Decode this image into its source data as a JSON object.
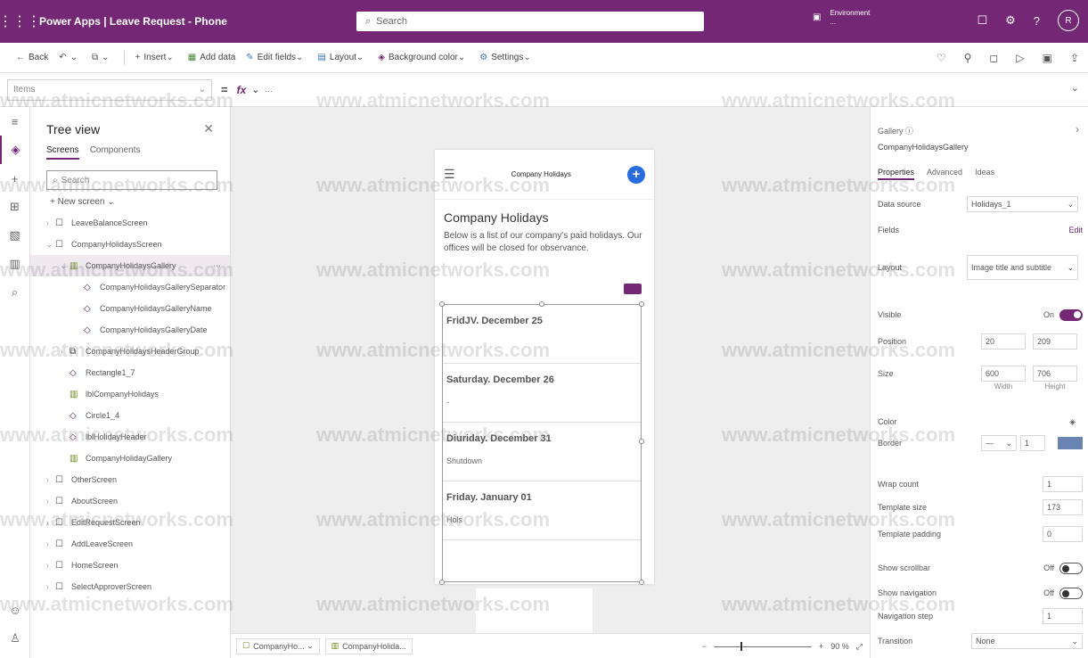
{
  "app": {
    "title": "Power Apps | Leave Request - Phone",
    "search_placeholder": "Search",
    "environment_line1": "Environment",
    "environment_line2": "...",
    "avatar_initials": "R"
  },
  "commandbar": {
    "back": "Back",
    "insert": "Insert",
    "add_data": "Add data",
    "edit_fields": "Edit fields",
    "layout": "Layout",
    "background_color": "Background color",
    "settings": "Settings"
  },
  "formulabar": {
    "property": "Items",
    "formula": "..."
  },
  "tree": {
    "title": "Tree view",
    "tabs": [
      "Screens",
      "Components"
    ],
    "search_placeholder": "Search",
    "new_screen": "New screen",
    "items": [
      {
        "label": "LeaveBalanceScreen",
        "indent": 0,
        "type": "screen",
        "chev": "›"
      },
      {
        "label": "CompanyHolidaysScreen",
        "indent": 0,
        "type": "screen",
        "chev": "⌄"
      },
      {
        "label": "CompanyHolidaysGallery",
        "indent": 1,
        "type": "gallery",
        "chev": "⌄",
        "selected": true
      },
      {
        "label": "CompanyHolidaysGallerySeparator",
        "indent": 2,
        "type": "control",
        "chev": ""
      },
      {
        "label": "CompanyHolidaysGalleryName",
        "indent": 2,
        "type": "control",
        "chev": ""
      },
      {
        "label": "CompanyHolidaysGalleryDate",
        "indent": 2,
        "type": "control",
        "chev": ""
      },
      {
        "label": "CompanyHolidaysHeaderGroup",
        "indent": 1,
        "type": "group",
        "chev": "›"
      },
      {
        "label": "Rectangle1_7",
        "indent": 1,
        "type": "control",
        "chev": ""
      },
      {
        "label": "lblCompanyHolidays",
        "indent": 1,
        "type": "gallery",
        "chev": ""
      },
      {
        "label": "Circle1_4",
        "indent": 1,
        "type": "control",
        "chev": ""
      },
      {
        "label": "lblHolidayHeader",
        "indent": 1,
        "type": "control",
        "chev": ""
      },
      {
        "label": "CompanyHolidayGallery",
        "indent": 1,
        "type": "gallery",
        "chev": ""
      },
      {
        "label": "OtherScreen",
        "indent": 0,
        "type": "screen",
        "chev": "›"
      },
      {
        "label": "AboutScreen",
        "indent": 0,
        "type": "screen",
        "chev": "›"
      },
      {
        "label": "EditRequestScreen",
        "indent": 0,
        "type": "screen",
        "chev": "›"
      },
      {
        "label": "AddLeaveScreen",
        "indent": 0,
        "type": "screen",
        "chev": "›"
      },
      {
        "label": "HomeScreen",
        "indent": 0,
        "type": "screen",
        "chev": "›"
      },
      {
        "label": "SelectApproverScreen",
        "indent": 0,
        "type": "screen",
        "chev": "›"
      }
    ]
  },
  "phone": {
    "header_title": "Company Holidays",
    "heading": "Company Holidays",
    "description": "Below is a list of our company's paid holidays. Our offices will be closed for observance.",
    "items": [
      {
        "date": "FridJV. December 25",
        "sub": ""
      },
      {
        "date": "Saturday. December 26",
        "sub": "-"
      },
      {
        "date": "Diuriday. December 31",
        "sub": "Shutdown"
      },
      {
        "date": "Friday. January 01",
        "sub": "Hols"
      }
    ]
  },
  "bottombar": {
    "crumb1": "CompanyHo...",
    "crumb2": "CompanyHolida...",
    "zoom": "90 %"
  },
  "props": {
    "control_type": "Gallery",
    "control_name": "CompanyHolidaysGallery",
    "tabs": [
      "Properties",
      "Advanced",
      "Ideas"
    ],
    "data_source_label": "Data source",
    "data_source_value": "Holidays_1",
    "fields_label": "Fields",
    "fields_action": "Edit",
    "layout_label": "Layout",
    "layout_value": "Image title and subtitle",
    "visible_label": "Visible",
    "visible_value": "On",
    "position_label": "Position",
    "position_x": "20",
    "position_y": "209",
    "size_label": "Size",
    "size_w": "600",
    "size_h": "706",
    "size_w_label": "Width",
    "size_h_label": "Height",
    "color_label": "Color",
    "border_label": "Border",
    "border_value": "1",
    "wrap_count_label": "Wrap count",
    "wrap_count_value": "1",
    "template_size_label": "Template size",
    "template_size_value": "173",
    "template_padding_label": "Template padding",
    "template_padding_value": "0",
    "show_scrollbar_label": "Show scrollbar",
    "show_scrollbar_value": "Off",
    "show_navigation_label": "Show navigation",
    "show_navigation_value": "Off",
    "navigation_step_label": "Navigation step",
    "navigation_step_value": "1",
    "transition_label": "Transition",
    "transition_value": "None"
  },
  "watermark": "www.atmicnetworks.com",
  "colors": {
    "brand": "#742774",
    "accent_button": "#2a6ce0"
  }
}
